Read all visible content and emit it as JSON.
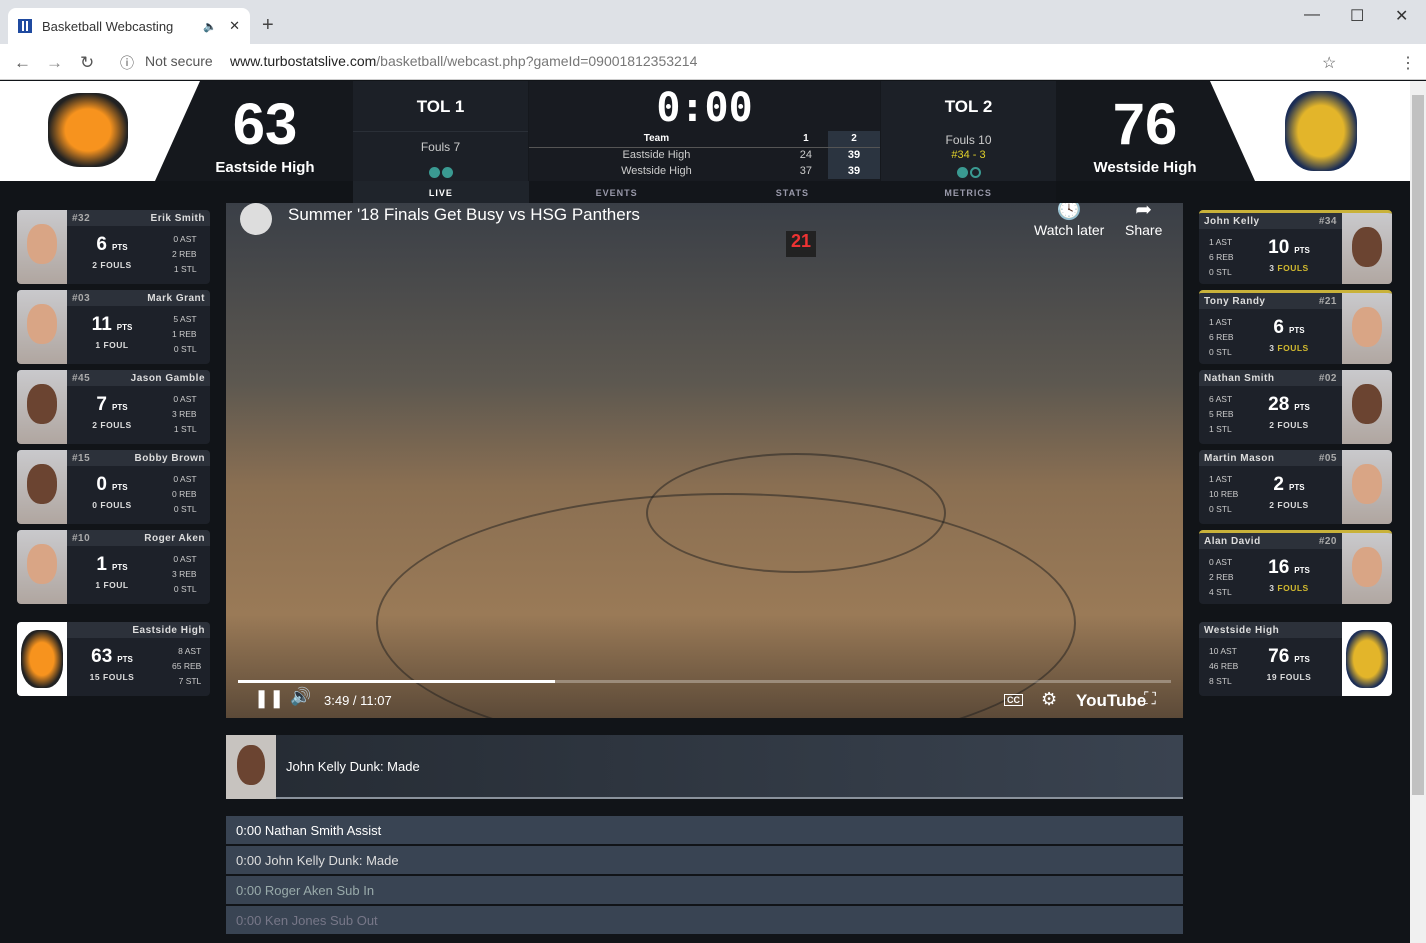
{
  "browser": {
    "tab_title": "Basketball Webcasting",
    "security": "Not secure",
    "url_host": "www.turbostatslive.com",
    "url_path": "/basketball/webcast.php?gameId=09001812353214"
  },
  "scoreboard": {
    "home": {
      "name": "Eastside High",
      "score": "63",
      "tol": "TOL  1",
      "fouls": "Fouls 7",
      "timeouts_used": 2,
      "timeouts_total": 2
    },
    "away": {
      "name": "Westside High",
      "score": "76",
      "tol": "TOL  2",
      "fouls": "Fouls 10",
      "bonus": "#34 - 3",
      "timeouts_used": 1,
      "timeouts_total": 2
    },
    "clock": "0:00",
    "periods": {
      "header": [
        "Team",
        "1",
        "2"
      ],
      "rows": [
        [
          "Eastside High",
          "24",
          "39"
        ],
        [
          "Westside High",
          "37",
          "39"
        ]
      ]
    },
    "tabs": [
      "LIVE",
      "EVENTS",
      "STATS",
      "METRICS"
    ],
    "active_tab": "LIVE"
  },
  "home_players": [
    {
      "num": "#32",
      "name": "Erik Smith",
      "pts": "6",
      "fouls": "2",
      "fouls_label": "FOULS",
      "ast": "0 AST",
      "reb": "2 REB",
      "stl": "1 STL"
    },
    {
      "num": "#03",
      "name": "Mark Grant",
      "pts": "11",
      "fouls": "1",
      "fouls_label": "FOUL",
      "ast": "5 AST",
      "reb": "1 REB",
      "stl": "0 STL"
    },
    {
      "num": "#45",
      "name": "Jason Gamble",
      "pts": "7",
      "fouls": "2",
      "fouls_label": "FOULS",
      "ast": "0 AST",
      "reb": "3 REB",
      "stl": "1 STL"
    },
    {
      "num": "#15",
      "name": "Bobby Brown",
      "pts": "0",
      "fouls": "0",
      "fouls_label": "FOULS",
      "ast": "0 AST",
      "reb": "0 REB",
      "stl": "0 STL"
    },
    {
      "num": "#10",
      "name": "Roger Aken",
      "pts": "1",
      "fouls": "1",
      "fouls_label": "FOUL",
      "ast": "0 AST",
      "reb": "3 REB",
      "stl": "0 STL"
    }
  ],
  "home_total": {
    "name": "Eastside High",
    "pts": "63",
    "fouls": "15",
    "fouls_label": "FOULS",
    "ast": "8 AST",
    "reb": "65 REB",
    "stl": "7 STL"
  },
  "away_players": [
    {
      "num": "#34",
      "name": "John Kelly",
      "pts": "10",
      "fouls": "3",
      "fouls_label": "FOULS",
      "ast": "1 AST",
      "reb": "6 REB",
      "stl": "0 STL",
      "warn": true
    },
    {
      "num": "#21",
      "name": "Tony Randy",
      "pts": "6",
      "fouls": "3",
      "fouls_label": "FOULS",
      "ast": "1 AST",
      "reb": "6 REB",
      "stl": "0 STL",
      "warn": true
    },
    {
      "num": "#02",
      "name": "Nathan Smith",
      "pts": "28",
      "fouls": "2",
      "fouls_label": "FOULS",
      "ast": "6 AST",
      "reb": "5 REB",
      "stl": "1 STL"
    },
    {
      "num": "#05",
      "name": "Martin Mason",
      "pts": "2",
      "fouls": "2",
      "fouls_label": "FOULS",
      "ast": "1 AST",
      "reb": "10 REB",
      "stl": "0 STL"
    },
    {
      "num": "#20",
      "name": "Alan David",
      "pts": "16",
      "fouls": "3",
      "fouls_label": "FOULS",
      "ast": "0 AST",
      "reb": "2 REB",
      "stl": "4 STL",
      "warn": true
    }
  ],
  "away_total": {
    "name": "Westside High",
    "pts": "76",
    "fouls": "19",
    "fouls_label": "FOULS",
    "ast": "10 AST",
    "reb": "46 REB",
    "stl": "8 STL"
  },
  "pts_label": "PTS",
  "video": {
    "title": "Summer '18 Finals Get Busy vs HSG Panthers",
    "watch_later": "Watch later",
    "share": "Share",
    "time": "3:49 / 11:07",
    "progress": 0.34,
    "brand": "YouTube",
    "cc": "CC"
  },
  "latest_event": "John Kelly Dunk: Made",
  "events": [
    "0:00 Nathan Smith Assist",
    "0:00 John Kelly Dunk: Made",
    "0:00 Roger Aken Sub In",
    "0:00 Ken Jones Sub Out"
  ]
}
